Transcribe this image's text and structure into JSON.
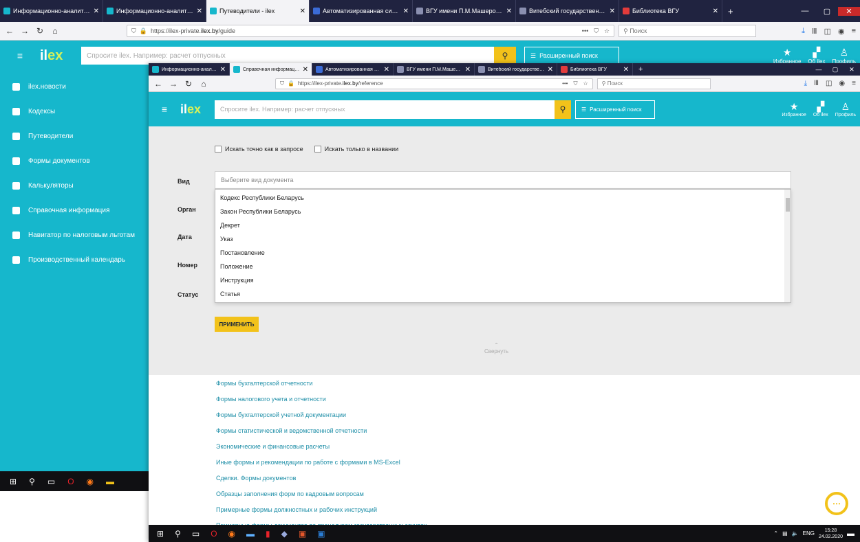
{
  "back": {
    "tabs": [
      {
        "title": "Информационно-аналитичес",
        "color": "#16b7cc",
        "active": false
      },
      {
        "title": "Информационно-аналитичес",
        "color": "#16b7cc",
        "active": false
      },
      {
        "title": "Путеводители - ilex",
        "color": "#16b7cc",
        "active": true
      },
      {
        "title": "Автоматизированная систем",
        "color": "#3b6bd6",
        "active": false
      },
      {
        "title": "ВГУ имени П.М.Машерова -",
        "color": "#8a8fb0",
        "active": false
      },
      {
        "title": "Витебский государственный",
        "color": "#8a8fb0",
        "active": false
      },
      {
        "title": "Библиотека ВГУ",
        "color": "#e23b3b",
        "active": false
      }
    ],
    "url_prefix": "https://ilex-private.",
    "url_host": "ilex.by",
    "url_path": "/guide",
    "search_placeholder": "Поиск",
    "logo_main": "il",
    "logo_accent": "ex",
    "query_placeholder": "Спросите ilex. Например: расчет отпускных",
    "advanced_search": "Расширенный поиск",
    "sidebar": [
      {
        "label": "ilex.новости"
      },
      {
        "label": "Кодексы"
      },
      {
        "label": "Путеводители"
      },
      {
        "label": "Формы документов"
      },
      {
        "label": "Калькуляторы"
      },
      {
        "label": "Справочная информация"
      },
      {
        "label": "Навигатор по налоговым льготам"
      },
      {
        "label": "Производственный календарь"
      }
    ],
    "favorites_label": "Избранное",
    "about_label": "Об ilex",
    "profile_label": "Профиль"
  },
  "front": {
    "tabs": [
      {
        "title": "Информационно-аналитичес",
        "color": "#16b7cc",
        "active": false
      },
      {
        "title": "Справочная информация - il",
        "color": "#16b7cc",
        "active": true
      },
      {
        "title": "Автоматизированная систем",
        "color": "#3b6bd6",
        "active": false
      },
      {
        "title": "ВГУ имени П.М.Машерова -",
        "color": "#8a8fb0",
        "active": false
      },
      {
        "title": "Витебский государственный",
        "color": "#8a8fb0",
        "active": false
      },
      {
        "title": "Библиотека ВГУ",
        "color": "#e23b3b",
        "active": false
      }
    ],
    "url_prefix": "https://ilex-private.",
    "url_host": "ilex.by",
    "url_path": "/reference",
    "search_placeholder": "Поиск",
    "logo_main": "il",
    "logo_accent": "ex",
    "query_placeholder": "Спросите ilex. Например: расчет отпускных",
    "advanced_search": "Расширенный поиск",
    "favorites_label": "Избранное",
    "about_label": "Об ilex",
    "profile_label": "Профиль",
    "filters": {
      "exact_match": "Искать точно как в запросе",
      "title_only": "Искать только в названии",
      "type_label": "Вид",
      "type_placeholder": "Выберите вид документа",
      "organ_label": "Орган",
      "date_label": "Дата",
      "number_label": "Номер",
      "status_label": "Статус",
      "options": [
        {
          "label": "Кодекс Республики Беларусь"
        },
        {
          "label": "Закон Республики Беларусь"
        },
        {
          "label": "Декрет"
        },
        {
          "label": "Указ"
        },
        {
          "label": "Постановление"
        },
        {
          "label": "Положение"
        },
        {
          "label": "Инструкция"
        },
        {
          "label": "Статья"
        }
      ],
      "apply": "ПРИМЕНИТЬ",
      "collapse": "Свернуть"
    },
    "links": [
      {
        "label": "Формы бухгалтерской отчетности"
      },
      {
        "label": "Формы налогового учета и отчетности"
      },
      {
        "label": "Формы бухгалтерской учетной документации"
      },
      {
        "label": "Формы статистической и ведомственной отчетности"
      },
      {
        "label": "Экономические и финансовые расчеты"
      },
      {
        "label": "Иные формы и рекомендации по работе с формами в MS-Excel"
      },
      {
        "label": "Сделки. Формы документов"
      },
      {
        "label": "Образцы заполнения форм по кадровым вопросам"
      },
      {
        "label": "Примерные формы должностных и рабочих инструкций"
      },
      {
        "label": "Примерные формы документов по процедурам государственных закупок"
      }
    ],
    "tray": {
      "lang": "ENG",
      "time": "15:28",
      "date": "24.02.2020"
    }
  }
}
